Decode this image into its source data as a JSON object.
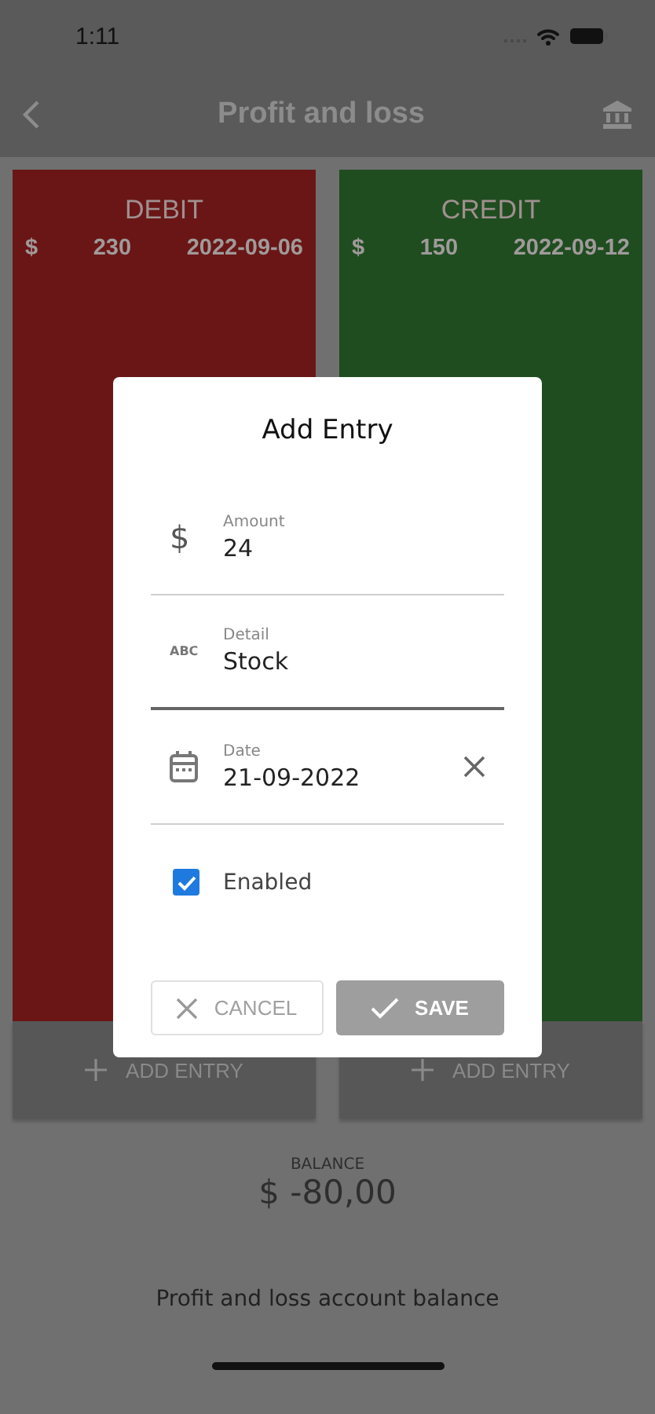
{
  "status_bar": {
    "time": "1:11"
  },
  "header": {
    "title": "Profit and loss"
  },
  "columns": [
    {
      "title": "DEBIT",
      "color": "#6a1616",
      "entries": [
        {
          "currency": "$",
          "amount": "230",
          "date": "2022-09-06"
        }
      ],
      "add_label": "ADD ENTRY"
    },
    {
      "title": "CREDIT",
      "color": "#1f4d20",
      "entries": [
        {
          "currency": "$",
          "amount": "150",
          "date": "2022-09-12"
        }
      ],
      "add_label": "ADD ENTRY"
    }
  ],
  "balance": {
    "label": "BALANCE",
    "value": "$ -80,00"
  },
  "footer": {
    "text": "Profit and loss account balance"
  },
  "dialog": {
    "title": "Add Entry",
    "fields": [
      {
        "kind": "text",
        "glyph": "$",
        "label": "Amount",
        "value": "24",
        "focused": false
      },
      {
        "kind": "text",
        "glyph": "ABC",
        "label": "Detail",
        "value": "Stock",
        "focused": true
      },
      {
        "kind": "date",
        "label": "Date",
        "value": "21-09-2022",
        "focused": false
      }
    ],
    "checkbox": {
      "label": "Enabled",
      "checked": true
    },
    "buttons": [
      {
        "kind": "cancel",
        "label": "CANCEL"
      },
      {
        "kind": "save",
        "label": "SAVE"
      }
    ]
  }
}
